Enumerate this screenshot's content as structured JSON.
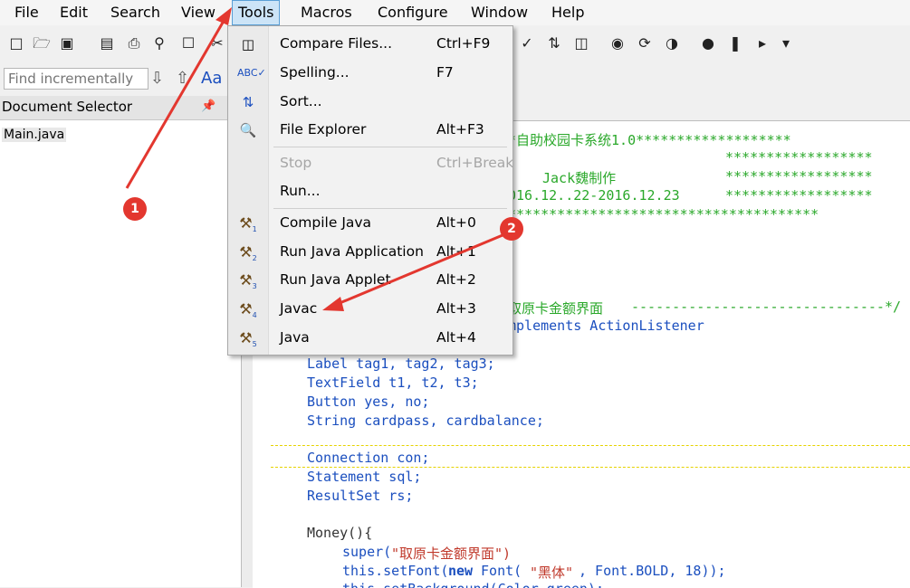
{
  "menubar": [
    "File",
    "Edit",
    "Search",
    "View",
    "Tools",
    "Macros",
    "Configure",
    "Window",
    "Help"
  ],
  "find": {
    "placeholder": "Find incrementally",
    "case_label": "Aa"
  },
  "doc_selector": {
    "title": "Document Selector",
    "pin": "\u0002",
    "file": "Main.java"
  },
  "tools_menu": {
    "items": [
      {
        "label": "Compare Files...",
        "shortcut": "Ctrl+F9",
        "icon": "compare-icon"
      },
      {
        "label": "Spelling...",
        "shortcut": "F7",
        "icon": "spelling-icon"
      },
      {
        "label": "Sort...",
        "shortcut": "",
        "icon": "sort-icon"
      },
      {
        "label": "File Explorer",
        "shortcut": "Alt+F3",
        "icon": "file-explorer-icon"
      },
      {
        "label": "Stop",
        "shortcut": "Ctrl+Break",
        "icon": ""
      },
      {
        "label": "Run...",
        "shortcut": "",
        "icon": ""
      },
      {
        "label": "Compile Java",
        "shortcut": "Alt+0",
        "icon": "hammer-1-icon"
      },
      {
        "label": "Run Java Application",
        "shortcut": "Alt+1",
        "icon": "hammer-2-icon"
      },
      {
        "label": "Run Java Applet",
        "shortcut": "Alt+2",
        "icon": "hammer-3-icon"
      },
      {
        "label": "Javac",
        "shortcut": "Alt+3",
        "icon": "hammer-4-icon"
      },
      {
        "label": "Java",
        "shortcut": "Alt+4",
        "icon": "hammer-5-icon"
      }
    ],
    "hammer_numbers": [
      "1",
      "2",
      "3",
      "4",
      "5"
    ]
  },
  "code": {
    "l1": "*自助校园卡系统1.0*******************",
    "l2": "******************",
    "l3a": "Jack魏制作",
    "l3b": "******************",
    "l4a": "016.12..22-2016.12.23",
    "l4b": "******************",
    "l5": "**************************************",
    "l6a": "取原卡金额界面",
    "l6b": "-------------------------------*/",
    "l7": "mplements ActionListener",
    "l8": "Label tag1, tag2, tag3;",
    "l9": "TextField t1, t2, t3;",
    "l10": "Button yes, no;",
    "l11": "String cardpass, cardbalance;",
    "l12": "Connection con;",
    "l13": "Statement sql;",
    "l14": "ResultSet rs;",
    "l15": "Money(){",
    "l16a": "super(",
    "l16b": "\"取原卡金额界面\")",
    "l17a": "this.setFont(",
    "l17b": "new",
    "l17c": " Font(",
    "l17d": "\"黑体\"",
    "l17e": ", Font.BOLD, 18));",
    "l18": "this.setBackground(Color.green);"
  },
  "callouts": [
    "1",
    "2"
  ],
  "colors": {
    "accent_red": "#e3372f",
    "code_green": "#2aa82a",
    "keyword_blue": "#1b4fbf"
  }
}
